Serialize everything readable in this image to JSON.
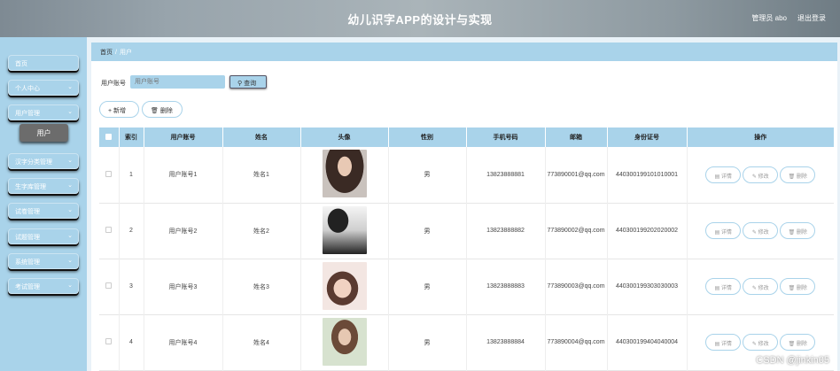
{
  "header": {
    "title": "幼儿识字APP的设计与实现",
    "user": "管理员 abo",
    "logout": "退出登录"
  },
  "sidebar": {
    "items": [
      {
        "label": "首页",
        "chevron": ""
      },
      {
        "label": "个人中心",
        "chevron": "⌄"
      },
      {
        "label": "用户管理",
        "chevron": "⌄"
      },
      {
        "label": "汉字分类管理",
        "chevron": "⌄"
      },
      {
        "label": "生字库管理",
        "chevron": "⌄"
      },
      {
        "label": "试卷管理",
        "chevron": "⌄"
      },
      {
        "label": "试题管理",
        "chevron": "⌄"
      },
      {
        "label": "系统管理",
        "chevron": "⌄"
      },
      {
        "label": "考试管理",
        "chevron": "⌄"
      }
    ],
    "sub_item": "用户"
  },
  "breadcrumb": {
    "home": "首页",
    "current": "用户"
  },
  "search": {
    "label": "用户账号",
    "placeholder": "用户账号",
    "button": "查询"
  },
  "actions": {
    "add": "新增",
    "delete": "删除"
  },
  "table": {
    "headers": [
      "索引",
      "用户账号",
      "姓名",
      "头像",
      "性别",
      "手机号码",
      "邮箱",
      "身份证号",
      "操作"
    ],
    "rows": [
      {
        "index": "1",
        "account": "用户账号1",
        "name": "姓名1",
        "gender": "男",
        "phone": "13823888881",
        "email": "773890001@qq.com",
        "id_card": "440300199101010001"
      },
      {
        "index": "2",
        "account": "用户账号2",
        "name": "姓名2",
        "gender": "男",
        "phone": "13823888882",
        "email": "773890002@qq.com",
        "id_card": "440300199202020002"
      },
      {
        "index": "3",
        "account": "用户账号3",
        "name": "姓名3",
        "gender": "男",
        "phone": "13823888883",
        "email": "773890003@qq.com",
        "id_card": "440300199303030003"
      },
      {
        "index": "4",
        "account": "用户账号4",
        "name": "姓名4",
        "gender": "男",
        "phone": "13823888884",
        "email": "773890004@qq.com",
        "id_card": "440300199404040004"
      }
    ],
    "row_ops": {
      "detail": "详情",
      "edit": "修改",
      "delete": "删除"
    }
  },
  "watermark": "CSDN @jinkin05",
  "colors": {
    "accent": "#a9d3ea",
    "header": "#98a4ac",
    "sub_item": "#6c6c6c"
  }
}
